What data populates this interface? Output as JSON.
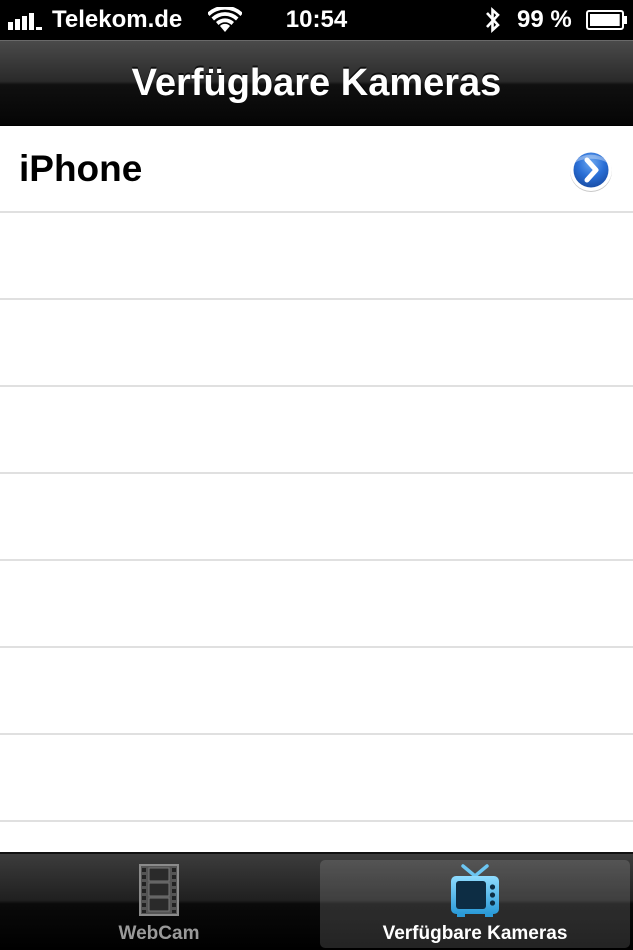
{
  "status_bar": {
    "carrier": "Telekom.de",
    "time": "10:54",
    "battery_percent": "99 %",
    "battery_level": 0.99,
    "signal_bars": 4
  },
  "nav_bar": {
    "title": "Verfügbare Kameras"
  },
  "cameras": [
    {
      "label": "iPhone",
      "accessory": "disclosure-icon"
    }
  ],
  "tab_bar": {
    "tabs": [
      {
        "label": "WebCam",
        "icon": "film-strip-icon",
        "selected": false
      },
      {
        "label": "Verfügbare Kameras",
        "icon": "tv-icon",
        "selected": true
      }
    ]
  },
  "colors": {
    "disclosure_blue": "#2a6fd6",
    "tab_inactive_text": "#9a9a9a",
    "tab_active_text": "#ffffff",
    "tv_icon_blue": "#3fb4ea"
  }
}
